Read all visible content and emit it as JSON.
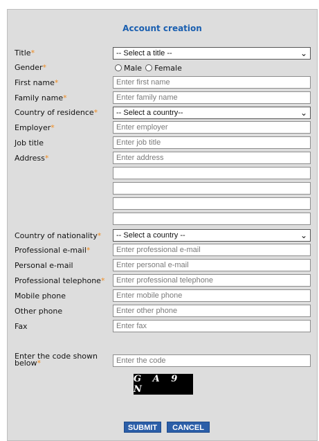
{
  "form": {
    "title": "Account creation",
    "required_marker": "*",
    "labels": {
      "title": "Title",
      "gender": "Gender",
      "first_name": "First name",
      "family_name": "Family name",
      "country_residence": "Country of residence",
      "employer": "Employer",
      "job_title": "Job title",
      "address": "Address",
      "country_nationality": "Country of nationality",
      "prof_email": "Professional e-mail",
      "personal_email": "Personal e-mail",
      "prof_phone": "Professional telephone",
      "mobile": "Mobile phone",
      "other_phone": "Other phone",
      "fax": "Fax",
      "code": "Enter the code shown below"
    },
    "selects": {
      "title": "-- Select a title --",
      "country_residence": "-- Select a country--",
      "country_nationality": "-- Select a country --"
    },
    "gender_options": {
      "male": "Male",
      "female": "Female"
    },
    "placeholders": {
      "first_name": "Enter first name",
      "family_name": "Enter family name",
      "employer": "Enter employer",
      "job_title": "Enter job title",
      "address": "Enter address",
      "prof_email": "Enter professional e-mail",
      "personal_email": "Enter personal e-mail",
      "prof_phone": "Enter professional telephone",
      "mobile": "Enter mobile phone",
      "other_phone": "Enter other phone",
      "fax": "Enter fax",
      "code": "Enter the code"
    },
    "captcha_text": "G A 9 N",
    "buttons": {
      "submit": "SUBMIT",
      "cancel": "CANCEL"
    }
  }
}
